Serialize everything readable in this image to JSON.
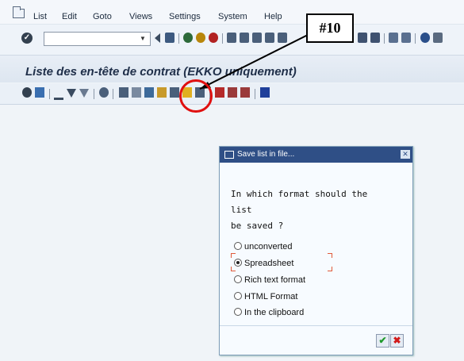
{
  "menu": {
    "items": [
      "List",
      "Edit",
      "Goto",
      "Views",
      "Settings",
      "System",
      "Help"
    ]
  },
  "command_field": {
    "value": ""
  },
  "page_title": "Liste des en-tête de contrat (EKKO uniquement)",
  "callout": {
    "label": "#10"
  },
  "dialog": {
    "title": "Save list in file...",
    "question": [
      "In which format should the",
      "list",
      "be saved ?"
    ],
    "options": [
      {
        "label": "unconverted",
        "selected": false
      },
      {
        "label": "Spreadsheet",
        "selected": true
      },
      {
        "label": "Rich text format",
        "selected": false
      },
      {
        "label": "HTML Format",
        "selected": false
      },
      {
        "label": "In the clipboard",
        "selected": false
      }
    ],
    "ok_icon": "check-icon",
    "cancel_icon": "cross-icon"
  },
  "colors": {
    "dialog_title_bar": "#2f4f86",
    "highlight_circle": "#e01010",
    "ok": "#1f9a2a",
    "cancel": "#d21a1a"
  }
}
